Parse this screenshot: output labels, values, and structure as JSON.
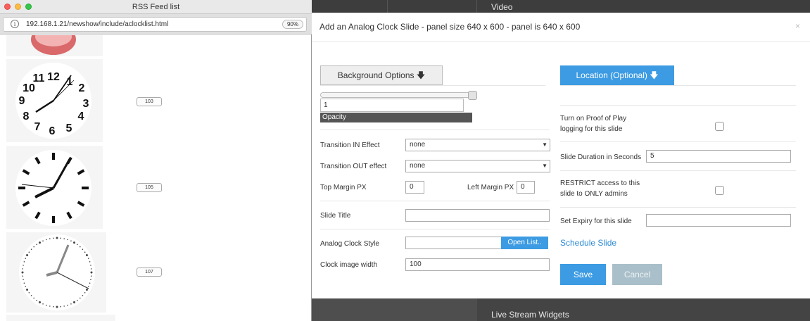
{
  "browser": {
    "window_title": "RSS Feed list",
    "url": "192.168.1.21/newshow/include/aclocklist.html",
    "zoom": "90%",
    "clocks": [
      {
        "id": "103",
        "numerals": [
          "12",
          "1",
          "2",
          "3",
          "4",
          "5",
          "6",
          "7",
          "8",
          "9",
          "10",
          "11"
        ]
      },
      {
        "id": "105"
      },
      {
        "id": "107"
      }
    ]
  },
  "background": {
    "top_label": "Video",
    "bottom_label": "Live Stream Widgets"
  },
  "modal": {
    "title": "Add an Analog Clock Slide - panel size 640 x 600 - panel is 640 x 600",
    "close": "×",
    "background_options": "Background Options 🡇",
    "location": "Location (Optional) 🡇",
    "opacity_value": "1",
    "opacity_label": "Opacity",
    "transition_in_label": "Transition IN Effect",
    "transition_in_value": "none",
    "transition_out_label": "Transition OUT effect",
    "transition_out_value": "none",
    "top_margin_label": "Top Margin PX",
    "top_margin_value": "0",
    "left_margin_label": "Left Margin PX",
    "left_margin_value": "0",
    "slide_title_label": "Slide Title",
    "slide_title_value": "",
    "clock_style_label": "Analog Clock Style",
    "clock_style_value": "",
    "open_list": "Open List..",
    "clock_width_label": "Clock image width",
    "clock_width_value": "100",
    "proof_of_play_label_1": "Turn on Proof of Play",
    "proof_of_play_label_2": "logging for this slide",
    "duration_label": "Slide Duration in Seconds",
    "duration_value": "5",
    "restrict_label_1": "RESTRICT access to this",
    "restrict_label_2": "slide to ONLY admins",
    "expiry_label": "Set Expiry for this slide",
    "expiry_value": "",
    "schedule": "Schedule Slide",
    "save": "Save",
    "cancel": "Cancel"
  }
}
